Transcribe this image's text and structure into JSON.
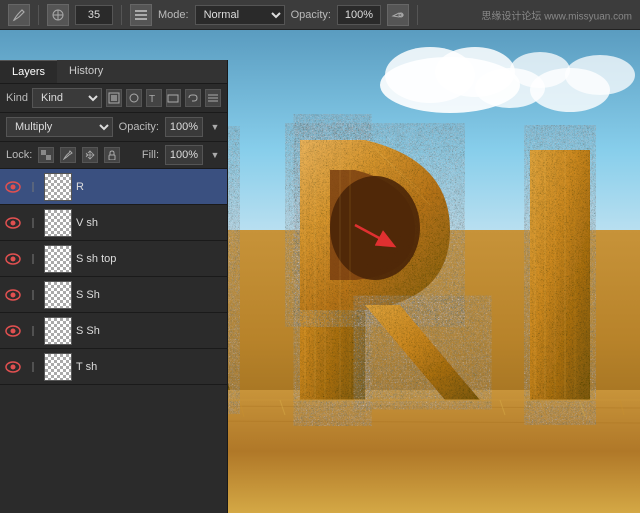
{
  "toolbar": {
    "brush_size": "35",
    "mode_label": "Mode:",
    "mode_value": "Normal",
    "opacity_label": "Opacity:",
    "opacity_value": "100%",
    "watermark": "思缘设计论坛 www.missyuan.com"
  },
  "layers_panel": {
    "tabs": [
      {
        "label": "Layers",
        "active": true
      },
      {
        "label": "History",
        "active": false
      }
    ],
    "kind_label": "Kind",
    "kind_select_value": "Kind",
    "icons": [
      "img-icon",
      "circle-icon",
      "T-icon",
      "rect-icon",
      "chain-icon",
      "grid-icon"
    ],
    "blend_mode": "Multiply",
    "opacity_label": "Opacity:",
    "opacity_value": "100%",
    "lock_label": "Lock:",
    "fill_label": "Fill:",
    "fill_value": "100%",
    "layers": [
      {
        "name": "R",
        "visible": true,
        "selected": true
      },
      {
        "name": "V sh",
        "visible": true,
        "selected": false
      },
      {
        "name": "S sh top",
        "visible": true,
        "selected": false
      },
      {
        "name": "S Sh",
        "visible": true,
        "selected": false
      },
      {
        "name": "S Sh",
        "visible": true,
        "selected": false
      },
      {
        "name": "T sh",
        "visible": true,
        "selected": false
      }
    ]
  },
  "canvas": {
    "arrow_color": "#e03030"
  }
}
